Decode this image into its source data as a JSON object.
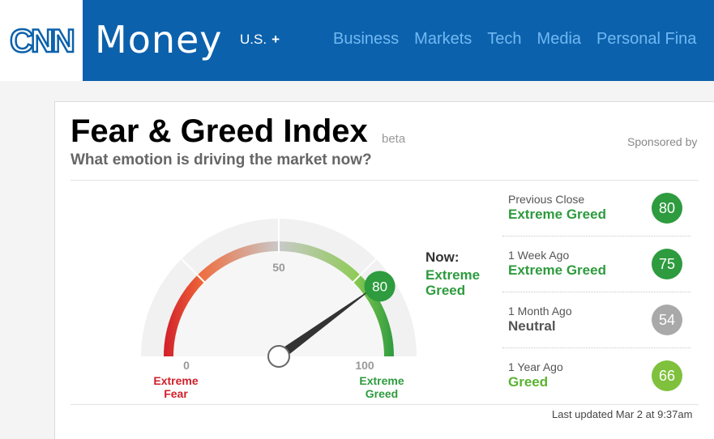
{
  "header": {
    "logo": "CNN",
    "brand": "Money",
    "edition": "U.S.",
    "edition_plus": "+",
    "nav": [
      "Business",
      "Markets",
      "Tech",
      "Media",
      "Personal Fina"
    ]
  },
  "card": {
    "title": "Fear & Greed Index",
    "beta": "beta",
    "sponsored": "Sponsored by",
    "subtitle": "What emotion is driving the market now?",
    "updated": "Last updated Mar 2 at 9:37am"
  },
  "gauge": {
    "value": 80,
    "min_label": "0",
    "mid_label": "50",
    "max_label": "100",
    "left_caption": [
      "Extreme",
      "Fear"
    ],
    "right_caption": [
      "Extreme",
      "Greed"
    ],
    "now_label": "Now:",
    "now_sentiment": "Extreme Greed",
    "colors": {
      "red": "#d11f2a",
      "orange": "#f06a3a",
      "gray": "#c9c9c9",
      "lightgreen": "#8ccb52",
      "green": "#2e9b3e",
      "needle": "#333333"
    }
  },
  "history": [
    {
      "label": "Previous Close",
      "sentiment": "Extreme Greed",
      "value": "80",
      "sentiment_color": "#2e9b3e",
      "badge_color": "#2e9b3e"
    },
    {
      "label": "1 Week Ago",
      "sentiment": "Extreme Greed",
      "value": "75",
      "sentiment_color": "#2e9b3e",
      "badge_color": "#2e9b3e"
    },
    {
      "label": "1 Month Ago",
      "sentiment": "Neutral",
      "value": "54",
      "sentiment_color": "#555555",
      "badge_color": "#a9a9a9"
    },
    {
      "label": "1 Year Ago",
      "sentiment": "Greed",
      "value": "66",
      "sentiment_color": "#5bb332",
      "badge_color": "#7fc13d"
    }
  ]
}
